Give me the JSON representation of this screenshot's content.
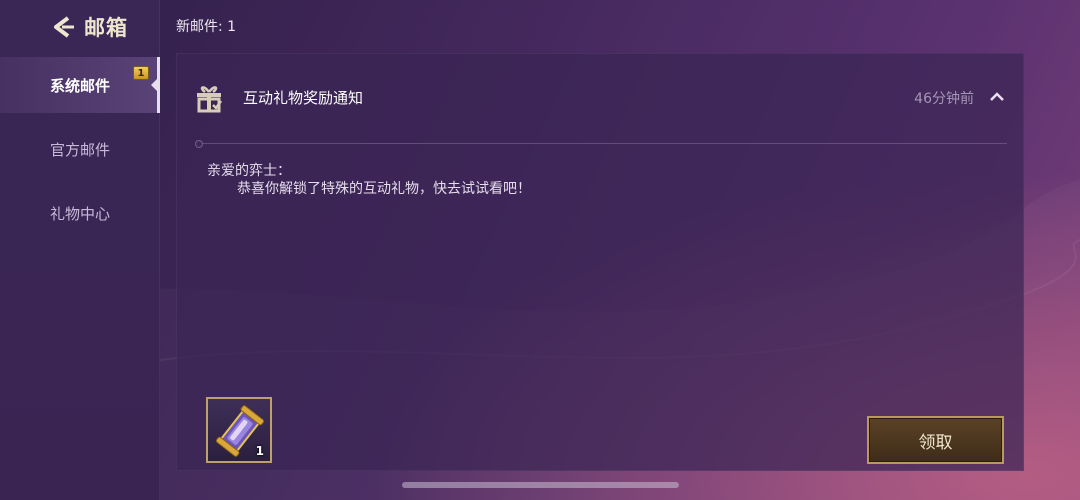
{
  "header": {
    "back_title": "邮箱",
    "new_mail_text": "新邮件: 1"
  },
  "sidebar": {
    "items": [
      {
        "label": "系统邮件",
        "badge": "1",
        "active": true
      },
      {
        "label": "官方邮件"
      },
      {
        "label": "礼物中心"
      }
    ]
  },
  "mail": {
    "title": "互动礼物奖励通知",
    "time": "46分钟前",
    "greeting": "亲爱的弈士：",
    "body": "恭喜你解锁了特殊的互动礼物，快去试试看吧！",
    "attachment": {
      "quantity": "1",
      "icon": "gift-scroll-icon"
    },
    "claim_label": "领取"
  },
  "colors": {
    "accent_gold": "#bca26a",
    "badge_yellow": "#f3cf58",
    "panel": "#3a2654"
  }
}
